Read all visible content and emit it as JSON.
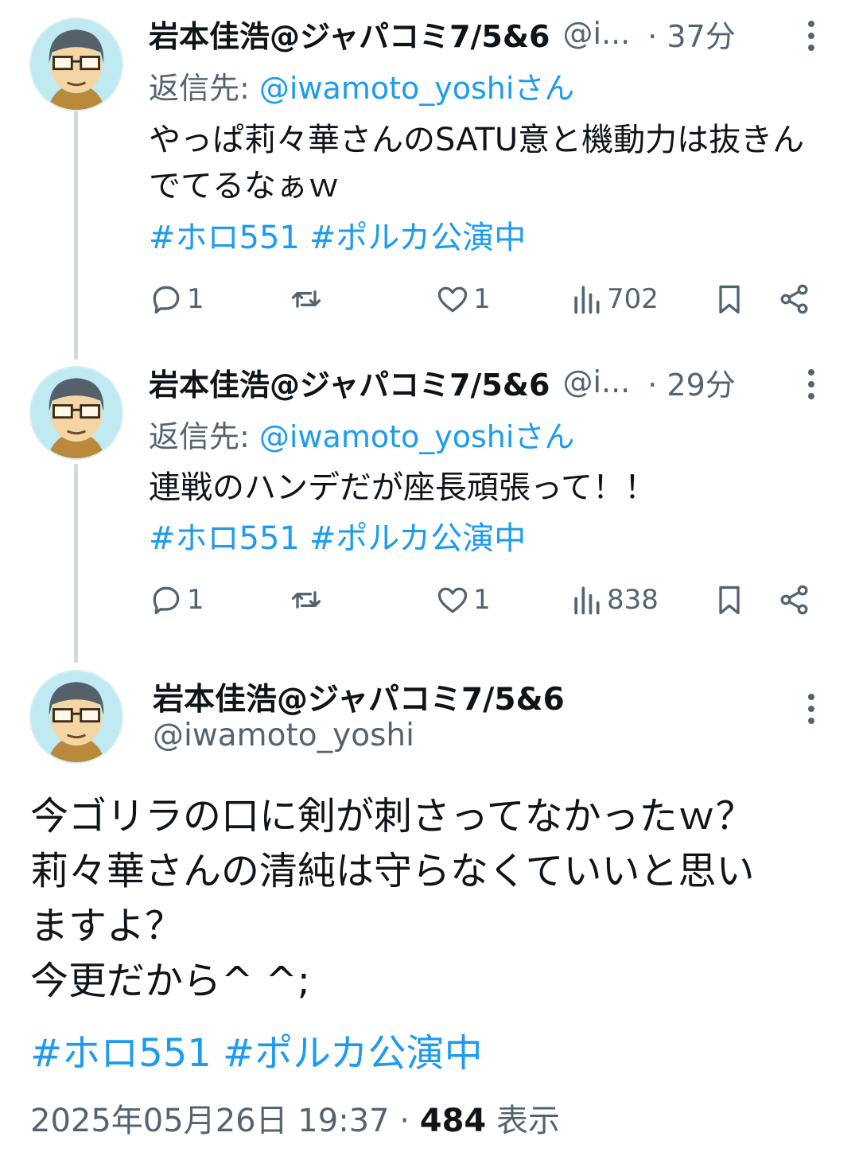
{
  "tweets": [
    {
      "display_name": "岩本佳浩@ジャパコミ7/5&6",
      "handle": "@i...",
      "time": "· 37分",
      "reply_prefix": "返信先: ",
      "reply_to": "@iwamoto_yoshiさん",
      "body": "やっぱ莉々華さんのSATU意と機動力は抜きんでてるなぁｗ",
      "hashtags": [
        "#ホロ551",
        "#ポルカ公演中"
      ],
      "replies": "1",
      "retweets": "",
      "likes": "1",
      "views": "702"
    },
    {
      "display_name": "岩本佳浩@ジャパコミ7/5&6",
      "handle": "@i...",
      "time": "· 29分",
      "reply_prefix": "返信先: ",
      "reply_to": "@iwamoto_yoshiさん",
      "body": "連戦のハンデだが座長頑張って！！",
      "hashtags": [
        "#ホロ551",
        "#ポルカ公演中"
      ],
      "replies": "1",
      "retweets": "",
      "likes": "1",
      "views": "838"
    }
  ],
  "main_tweet": {
    "display_name": "岩本佳浩@ジャパコミ7/5&6",
    "handle": "@iwamoto_yoshi",
    "lines": [
      "今ゴリラの口に剣が刺さってなかったｗ？",
      "莉々華さんの清純は守らなくていいと思い",
      "ますよ？",
      "今更だから^ ^;"
    ],
    "hashtags": [
      "#ホロ551",
      "#ポルカ公演中"
    ],
    "timestamp": "2025年05月26日 19:37 · ",
    "views_count": "484",
    "views_label": " 表示"
  },
  "icons": {
    "reply": "reply-icon",
    "retweet": "retweet-icon",
    "like": "heart-icon",
    "views": "analytics-icon",
    "bookmark": "bookmark-icon",
    "share": "share-icon",
    "more": "more-vertical-icon"
  },
  "colors": {
    "link": "#1d9bf0",
    "secondary_text": "#536471",
    "primary_text": "#0f1419",
    "thread_line": "#cfd9de"
  }
}
